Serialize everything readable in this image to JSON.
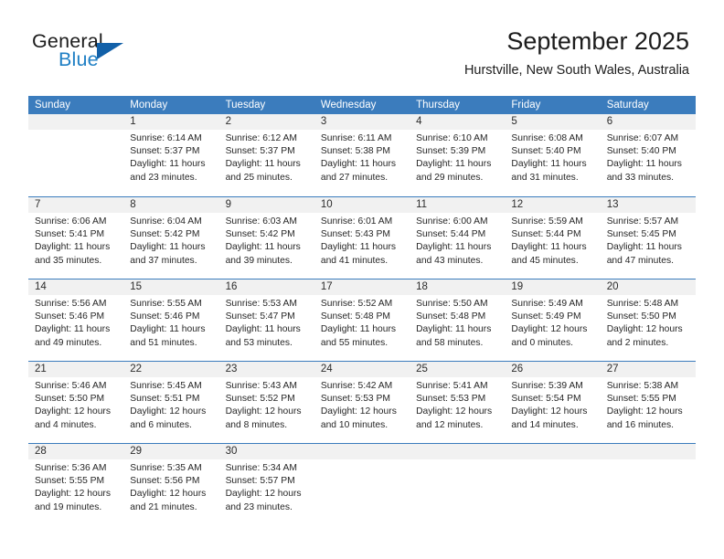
{
  "brand": {
    "line1": "General",
    "line2": "Blue",
    "accent_blue": "#1260a8",
    "text_blue": "#1f7fc4"
  },
  "header": {
    "month_title": "September 2025",
    "location": "Hurstville, New South Wales, Australia",
    "header_bg": "#3b7cbd"
  },
  "weekdays": [
    "Sunday",
    "Monday",
    "Tuesday",
    "Wednesday",
    "Thursday",
    "Friday",
    "Saturday"
  ],
  "weeks": [
    [
      {
        "day": "",
        "sunrise": "",
        "sunset": "",
        "daylight1": "",
        "daylight2": ""
      },
      {
        "day": "1",
        "sunrise": "Sunrise: 6:14 AM",
        "sunset": "Sunset: 5:37 PM",
        "daylight1": "Daylight: 11 hours",
        "daylight2": "and 23 minutes."
      },
      {
        "day": "2",
        "sunrise": "Sunrise: 6:12 AM",
        "sunset": "Sunset: 5:37 PM",
        "daylight1": "Daylight: 11 hours",
        "daylight2": "and 25 minutes."
      },
      {
        "day": "3",
        "sunrise": "Sunrise: 6:11 AM",
        "sunset": "Sunset: 5:38 PM",
        "daylight1": "Daylight: 11 hours",
        "daylight2": "and 27 minutes."
      },
      {
        "day": "4",
        "sunrise": "Sunrise: 6:10 AM",
        "sunset": "Sunset: 5:39 PM",
        "daylight1": "Daylight: 11 hours",
        "daylight2": "and 29 minutes."
      },
      {
        "day": "5",
        "sunrise": "Sunrise: 6:08 AM",
        "sunset": "Sunset: 5:40 PM",
        "daylight1": "Daylight: 11 hours",
        "daylight2": "and 31 minutes."
      },
      {
        "day": "6",
        "sunrise": "Sunrise: 6:07 AM",
        "sunset": "Sunset: 5:40 PM",
        "daylight1": "Daylight: 11 hours",
        "daylight2": "and 33 minutes."
      }
    ],
    [
      {
        "day": "7",
        "sunrise": "Sunrise: 6:06 AM",
        "sunset": "Sunset: 5:41 PM",
        "daylight1": "Daylight: 11 hours",
        "daylight2": "and 35 minutes."
      },
      {
        "day": "8",
        "sunrise": "Sunrise: 6:04 AM",
        "sunset": "Sunset: 5:42 PM",
        "daylight1": "Daylight: 11 hours",
        "daylight2": "and 37 minutes."
      },
      {
        "day": "9",
        "sunrise": "Sunrise: 6:03 AM",
        "sunset": "Sunset: 5:42 PM",
        "daylight1": "Daylight: 11 hours",
        "daylight2": "and 39 minutes."
      },
      {
        "day": "10",
        "sunrise": "Sunrise: 6:01 AM",
        "sunset": "Sunset: 5:43 PM",
        "daylight1": "Daylight: 11 hours",
        "daylight2": "and 41 minutes."
      },
      {
        "day": "11",
        "sunrise": "Sunrise: 6:00 AM",
        "sunset": "Sunset: 5:44 PM",
        "daylight1": "Daylight: 11 hours",
        "daylight2": "and 43 minutes."
      },
      {
        "day": "12",
        "sunrise": "Sunrise: 5:59 AM",
        "sunset": "Sunset: 5:44 PM",
        "daylight1": "Daylight: 11 hours",
        "daylight2": "and 45 minutes."
      },
      {
        "day": "13",
        "sunrise": "Sunrise: 5:57 AM",
        "sunset": "Sunset: 5:45 PM",
        "daylight1": "Daylight: 11 hours",
        "daylight2": "and 47 minutes."
      }
    ],
    [
      {
        "day": "14",
        "sunrise": "Sunrise: 5:56 AM",
        "sunset": "Sunset: 5:46 PM",
        "daylight1": "Daylight: 11 hours",
        "daylight2": "and 49 minutes."
      },
      {
        "day": "15",
        "sunrise": "Sunrise: 5:55 AM",
        "sunset": "Sunset: 5:46 PM",
        "daylight1": "Daylight: 11 hours",
        "daylight2": "and 51 minutes."
      },
      {
        "day": "16",
        "sunrise": "Sunrise: 5:53 AM",
        "sunset": "Sunset: 5:47 PM",
        "daylight1": "Daylight: 11 hours",
        "daylight2": "and 53 minutes."
      },
      {
        "day": "17",
        "sunrise": "Sunrise: 5:52 AM",
        "sunset": "Sunset: 5:48 PM",
        "daylight1": "Daylight: 11 hours",
        "daylight2": "and 55 minutes."
      },
      {
        "day": "18",
        "sunrise": "Sunrise: 5:50 AM",
        "sunset": "Sunset: 5:48 PM",
        "daylight1": "Daylight: 11 hours",
        "daylight2": "and 58 minutes."
      },
      {
        "day": "19",
        "sunrise": "Sunrise: 5:49 AM",
        "sunset": "Sunset: 5:49 PM",
        "daylight1": "Daylight: 12 hours",
        "daylight2": "and 0 minutes."
      },
      {
        "day": "20",
        "sunrise": "Sunrise: 5:48 AM",
        "sunset": "Sunset: 5:50 PM",
        "daylight1": "Daylight: 12 hours",
        "daylight2": "and 2 minutes."
      }
    ],
    [
      {
        "day": "21",
        "sunrise": "Sunrise: 5:46 AM",
        "sunset": "Sunset: 5:50 PM",
        "daylight1": "Daylight: 12 hours",
        "daylight2": "and 4 minutes."
      },
      {
        "day": "22",
        "sunrise": "Sunrise: 5:45 AM",
        "sunset": "Sunset: 5:51 PM",
        "daylight1": "Daylight: 12 hours",
        "daylight2": "and 6 minutes."
      },
      {
        "day": "23",
        "sunrise": "Sunrise: 5:43 AM",
        "sunset": "Sunset: 5:52 PM",
        "daylight1": "Daylight: 12 hours",
        "daylight2": "and 8 minutes."
      },
      {
        "day": "24",
        "sunrise": "Sunrise: 5:42 AM",
        "sunset": "Sunset: 5:53 PM",
        "daylight1": "Daylight: 12 hours",
        "daylight2": "and 10 minutes."
      },
      {
        "day": "25",
        "sunrise": "Sunrise: 5:41 AM",
        "sunset": "Sunset: 5:53 PM",
        "daylight1": "Daylight: 12 hours",
        "daylight2": "and 12 minutes."
      },
      {
        "day": "26",
        "sunrise": "Sunrise: 5:39 AM",
        "sunset": "Sunset: 5:54 PM",
        "daylight1": "Daylight: 12 hours",
        "daylight2": "and 14 minutes."
      },
      {
        "day": "27",
        "sunrise": "Sunrise: 5:38 AM",
        "sunset": "Sunset: 5:55 PM",
        "daylight1": "Daylight: 12 hours",
        "daylight2": "and 16 minutes."
      }
    ],
    [
      {
        "day": "28",
        "sunrise": "Sunrise: 5:36 AM",
        "sunset": "Sunset: 5:55 PM",
        "daylight1": "Daylight: 12 hours",
        "daylight2": "and 19 minutes."
      },
      {
        "day": "29",
        "sunrise": "Sunrise: 5:35 AM",
        "sunset": "Sunset: 5:56 PM",
        "daylight1": "Daylight: 12 hours",
        "daylight2": "and 21 minutes."
      },
      {
        "day": "30",
        "sunrise": "Sunrise: 5:34 AM",
        "sunset": "Sunset: 5:57 PM",
        "daylight1": "Daylight: 12 hours",
        "daylight2": "and 23 minutes."
      },
      {
        "day": "",
        "sunrise": "",
        "sunset": "",
        "daylight1": "",
        "daylight2": ""
      },
      {
        "day": "",
        "sunrise": "",
        "sunset": "",
        "daylight1": "",
        "daylight2": ""
      },
      {
        "day": "",
        "sunrise": "",
        "sunset": "",
        "daylight1": "",
        "daylight2": ""
      },
      {
        "day": "",
        "sunrise": "",
        "sunset": "",
        "daylight1": "",
        "daylight2": ""
      }
    ]
  ]
}
